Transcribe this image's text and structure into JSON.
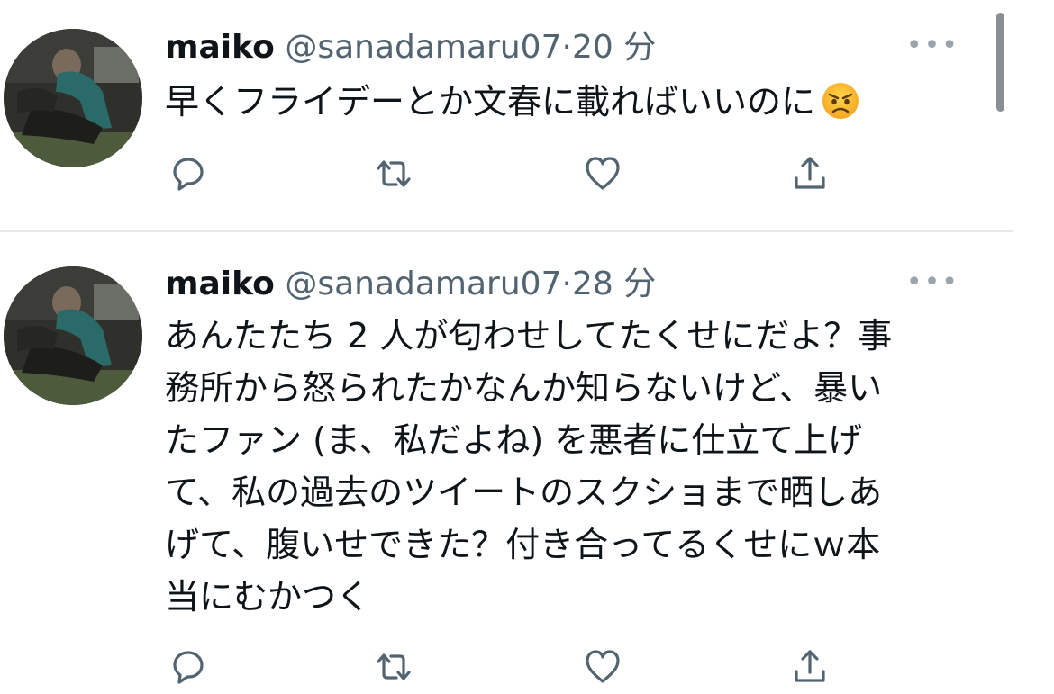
{
  "tweets": [
    {
      "name": "maiko",
      "handle": "@sanadamaru07",
      "separator": "·",
      "time": "20 分",
      "more": "•••",
      "text": "早くフライデーとか文春に載ればいいのに",
      "emoji": "angry-face-icon"
    },
    {
      "name": "maiko",
      "handle": "@sanadamaru07",
      "separator": "·",
      "time": "28 分",
      "more": "•••",
      "text": "あんたたち 2 人が匂わせしてたくせにだよ？事\n務所から怒られたかなんか知らないけど、暴い\nたファン (ま、私だよね) を悪者に仕立て上げ\nて、私の過去のツイートのスクショまで晒しあ\nげて、腹いせできた？付き合ってるくせにｗ本\n当にむかつく"
    }
  ],
  "actions": [
    "reply-icon",
    "retweet-icon",
    "like-icon",
    "share-icon"
  ],
  "colors": {
    "text": "#0f1419",
    "secondary": "#536471",
    "divider": "#e6e9ec",
    "icon": "#536471"
  }
}
